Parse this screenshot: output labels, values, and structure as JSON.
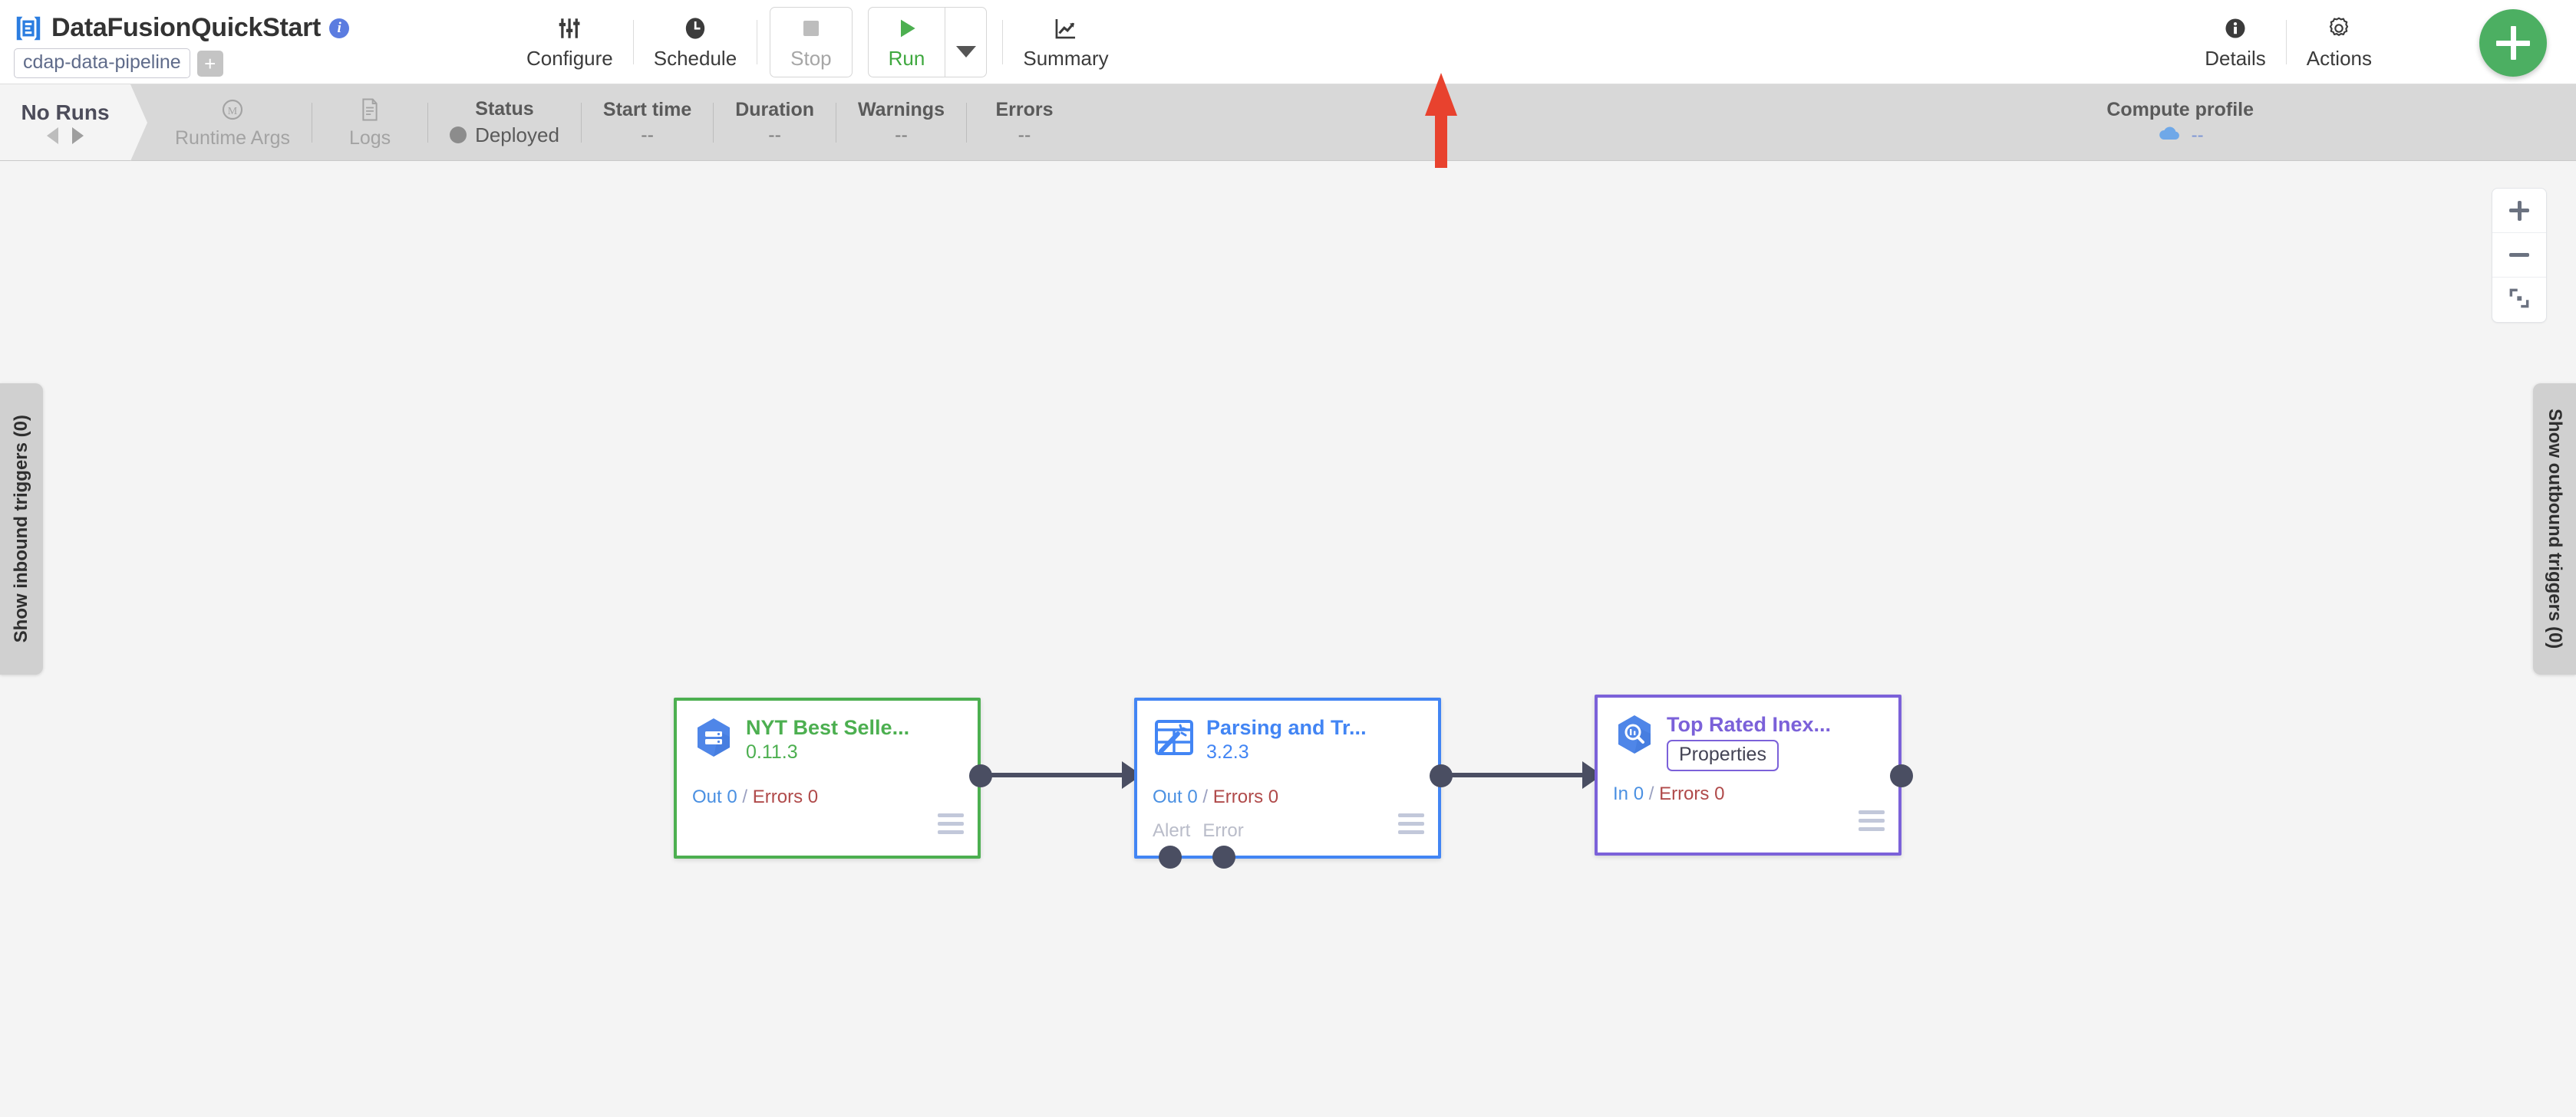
{
  "header": {
    "logo_icon": "cdap-logo-icon",
    "title": "DataFusionQuickStart",
    "info_icon": "info-icon",
    "artifact_chip": "cdap-data-pipeline",
    "add_chip_label": "+",
    "tools": [
      {
        "id": "configure",
        "label": "Configure",
        "icon": "sliders-icon"
      },
      {
        "id": "schedule",
        "label": "Schedule",
        "icon": "clock-icon"
      },
      {
        "id": "stop",
        "label": "Stop",
        "icon": "stop-square-icon"
      },
      {
        "id": "run",
        "label": "Run",
        "icon": "play-triangle-icon"
      },
      {
        "id": "summary",
        "label": "Summary",
        "icon": "line-chart-icon"
      }
    ],
    "run_dropdown_icon": "chevron-down-icon",
    "right_tools": [
      {
        "id": "details",
        "label": "Details",
        "icon": "info-circle-icon"
      },
      {
        "id": "actions",
        "label": "Actions",
        "icon": "gear-icon"
      }
    ],
    "fab": {
      "icon": "plus-icon",
      "color": "#4caf62"
    }
  },
  "statusbar": {
    "runs_label": "No Runs",
    "prev_icon": "triangle-left-icon",
    "next_icon": "triangle-right-icon",
    "runtime_args": {
      "label": "Runtime Args",
      "icon": "macro-m-icon"
    },
    "logs": {
      "label": "Logs",
      "icon": "document-icon"
    },
    "columns": [
      {
        "head": "Status",
        "value": "Deployed",
        "dot": true
      },
      {
        "head": "Start time",
        "value": "--"
      },
      {
        "head": "Duration",
        "value": "--"
      },
      {
        "head": "Warnings",
        "value": "--"
      },
      {
        "head": "Errors",
        "value": "--"
      }
    ],
    "compute_profile": {
      "head": "Compute profile",
      "icon": "cloud-icon",
      "value": "--"
    }
  },
  "canvas": {
    "zoom_controls": [
      {
        "id": "zoom-in",
        "icon": "plus-icon"
      },
      {
        "id": "zoom-out",
        "icon": "minus-icon"
      },
      {
        "id": "fit",
        "icon": "fit-to-screen-icon"
      }
    ],
    "inbound_trigger_tab": "Show inbound triggers (0)",
    "outbound_trigger_tab": "Show outbound triggers (0)",
    "nodes": [
      {
        "id": "source",
        "name": "NYT Best Selle...",
        "version": "0.11.3",
        "icon": "bigquery-source-icon",
        "accent": "#4caf50",
        "metrics": {
          "left_label": "Out",
          "left_value": "0",
          "right_label": "Errors",
          "right_value": "0"
        },
        "ports": [],
        "properties_chip": null,
        "menu_icon": "hamburger-icon"
      },
      {
        "id": "wrangler",
        "name": "Parsing and Tr...",
        "version": "3.2.3",
        "icon": "wrangler-icon",
        "accent": "#4285f4",
        "metrics": {
          "left_label": "Out",
          "left_value": "0",
          "right_label": "Errors",
          "right_value": "0"
        },
        "ports": [
          "Alert",
          "Error"
        ],
        "properties_chip": null,
        "menu_icon": "hamburger-icon"
      },
      {
        "id": "sink",
        "name": "Top Rated Inex...",
        "version": "",
        "icon": "bigquery-sink-icon",
        "accent": "#7b61d9",
        "metrics": {
          "left_label": "In",
          "left_value": "0",
          "right_label": "Errors",
          "right_value": "0"
        },
        "ports": [],
        "properties_chip": "Properties",
        "menu_icon": "hamburger-icon"
      }
    ],
    "annotation": {
      "type": "red-arrow",
      "points_at": "run-button",
      "color": "#e8422e"
    }
  }
}
